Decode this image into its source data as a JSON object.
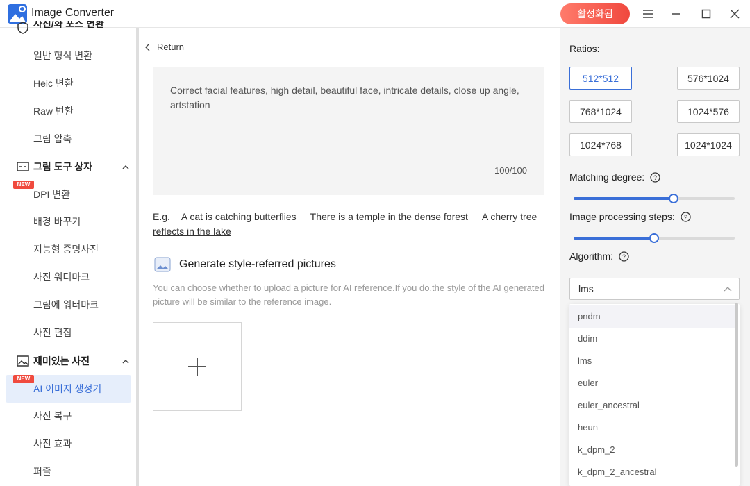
{
  "app": {
    "title": "Image Converter",
    "activate_label": "활성화됨"
  },
  "sidebar": {
    "group_partial": "사진/화 포스 변환",
    "items_group1": [
      "일반 형식 변환",
      "Heic 변환",
      "Raw 변환",
      "그림 압축"
    ],
    "group2": "그림 도구 상자",
    "items_group2": [
      "DPI 변환",
      "배경 바꾸기",
      "지능형 증명사진",
      "사진 워터마크",
      "그림에 워터마크",
      "사진 편집"
    ],
    "group3": "재미있는 사진",
    "items_group3": [
      "AI 이미지 생성기",
      "사진 복구",
      "사진 효과",
      "퍼즐"
    ],
    "new_badge": "NEW"
  },
  "main": {
    "return_label": "Return",
    "prompt": "Correct facial features, high detail, beautiful face, intricate details, close up angle, artstation",
    "prompt_count": "100/100",
    "examples_prefix": "E.g.",
    "examples": [
      "A cat is catching butterflies",
      "There is a temple in the dense forest",
      "A cherry tree reflects in the lake"
    ],
    "style_title": "Generate style-referred pictures",
    "style_desc": "You can choose whether to upload a picture for AI reference.If you do,the style of the AI generated picture will be similar to the reference image."
  },
  "right": {
    "ratios_label": "Ratios:",
    "ratios": [
      "512*512",
      "576*1024",
      "768*1024",
      "1024*576",
      "1024*768",
      "1024*1024"
    ],
    "matching_label": "Matching degree:",
    "matching_value": 0.62,
    "steps_label": "Image processing steps:",
    "steps_value": 0.5,
    "algorithm_label": "Algorithm:",
    "algorithm_selected": "lms",
    "algorithm_options": [
      "pndm",
      "ddim",
      "lms",
      "euler",
      "euler_ancestral",
      "heun",
      "k_dpm_2",
      "k_dpm_2_ancestral"
    ]
  },
  "colors": {
    "accent": "#3a6fd8",
    "activate": "#f0483e",
    "badge": "#f04a3e"
  }
}
